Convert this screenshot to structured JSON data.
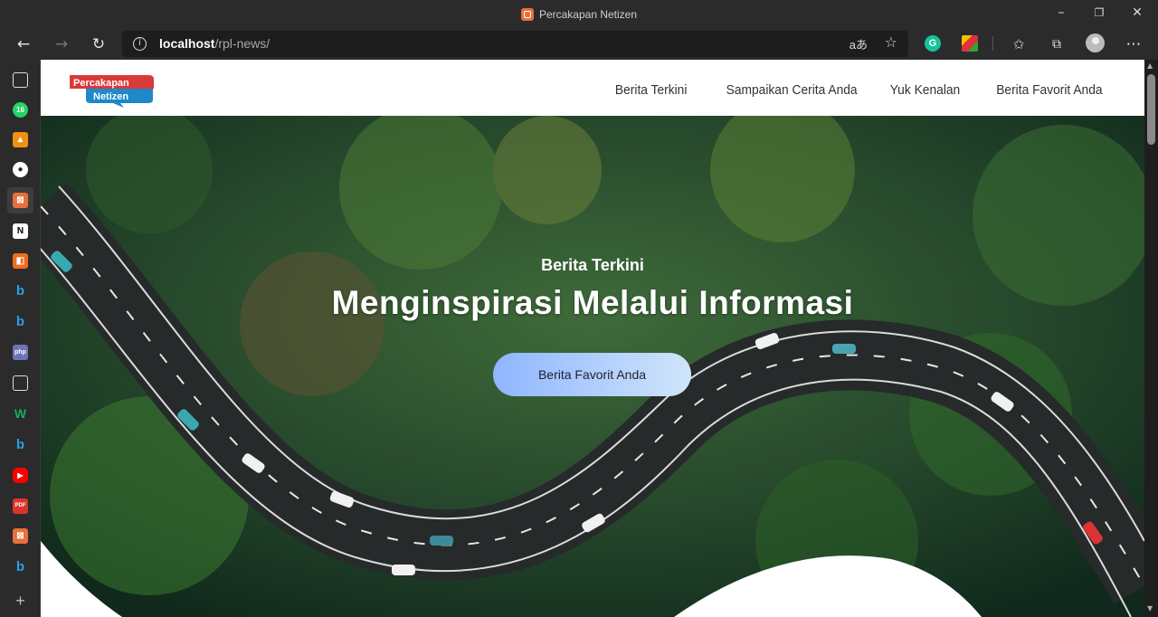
{
  "window": {
    "title": "Percakapan Netizen",
    "controls": [
      "minimize-icon",
      "restore-icon",
      "close-icon"
    ]
  },
  "browser": {
    "url_host": "localhost",
    "url_path": "/rpl-news/",
    "read_aloud": "aあ",
    "extensions": [
      "grammarly-icon",
      "colorful-extension-icon"
    ],
    "whatsapp_badge": "16"
  },
  "sidebar": {
    "icons": [
      "tabs-icon",
      "whatsapp-icon",
      "orange-app-icon",
      "github-icon",
      "xampp-icon",
      "notion-icon",
      "orange-app-icon",
      "bing-icon",
      "bing-icon",
      "php-icon",
      "document-icon",
      "w-icon",
      "bing-icon",
      "youtube-icon",
      "pdf-icon",
      "xampp-icon",
      "bing-icon",
      "add-icon"
    ]
  },
  "site": {
    "logo_line1": "Percakapan",
    "logo_line2": "Netizen",
    "menu": [
      "Berita Terkini",
      "Sampaikan Cerita Anda",
      "Yuk Kenalan",
      "Berita Favorit Anda"
    ]
  },
  "hero": {
    "kicker": "Berita Terkini",
    "headline": "Menginspirasi Melalui Informasi",
    "button": "Berita Favorit Anda"
  }
}
